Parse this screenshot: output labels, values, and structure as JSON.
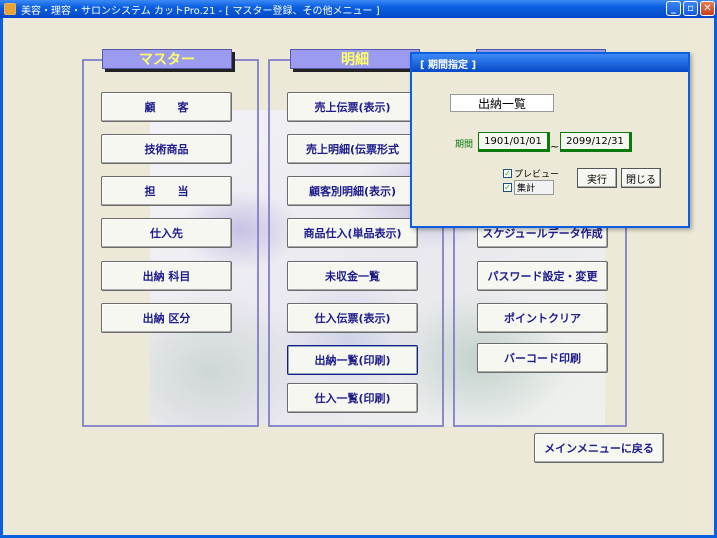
{
  "window": {
    "title": "美容・理容・サロンシステム カットPro.21 - [ マスター登録、その他メニュー ]",
    "minimize": "_",
    "maximize": "▫",
    "close": "✕"
  },
  "master": {
    "heading": "マスター",
    "buttons": [
      "顧　　客",
      "技術商品",
      "担　　当",
      "仕入先",
      "出納 科目",
      "出納 区分"
    ]
  },
  "detail": {
    "heading": "明細",
    "buttons": [
      "売上伝票(表示)",
      "売上明細(伝票形式",
      "顧客別明細(表示)",
      "商品仕入(単品表示)",
      "未収金一覧",
      "仕入伝票(表示)",
      "出納一覧(印刷)",
      "仕入一覧(印刷)"
    ]
  },
  "other": {
    "buttons": [
      "スケジュールデータ作成",
      "パスワード設定・変更",
      "ポイントクリア",
      "バーコード印刷"
    ]
  },
  "back_button": "メインメニューに戻る",
  "dialog": {
    "title": "[ 期間指定 ]",
    "report_name": "出納一覧",
    "period_label": "期間",
    "date_from": "1901/01/01",
    "date_to": "2099/12/31",
    "tilde": "~",
    "preview_label": "プレビュー",
    "total_label": "集計",
    "preview_checked": "✓",
    "total_checked": "✓",
    "run_label": "実行",
    "close_label": "閉じる"
  }
}
